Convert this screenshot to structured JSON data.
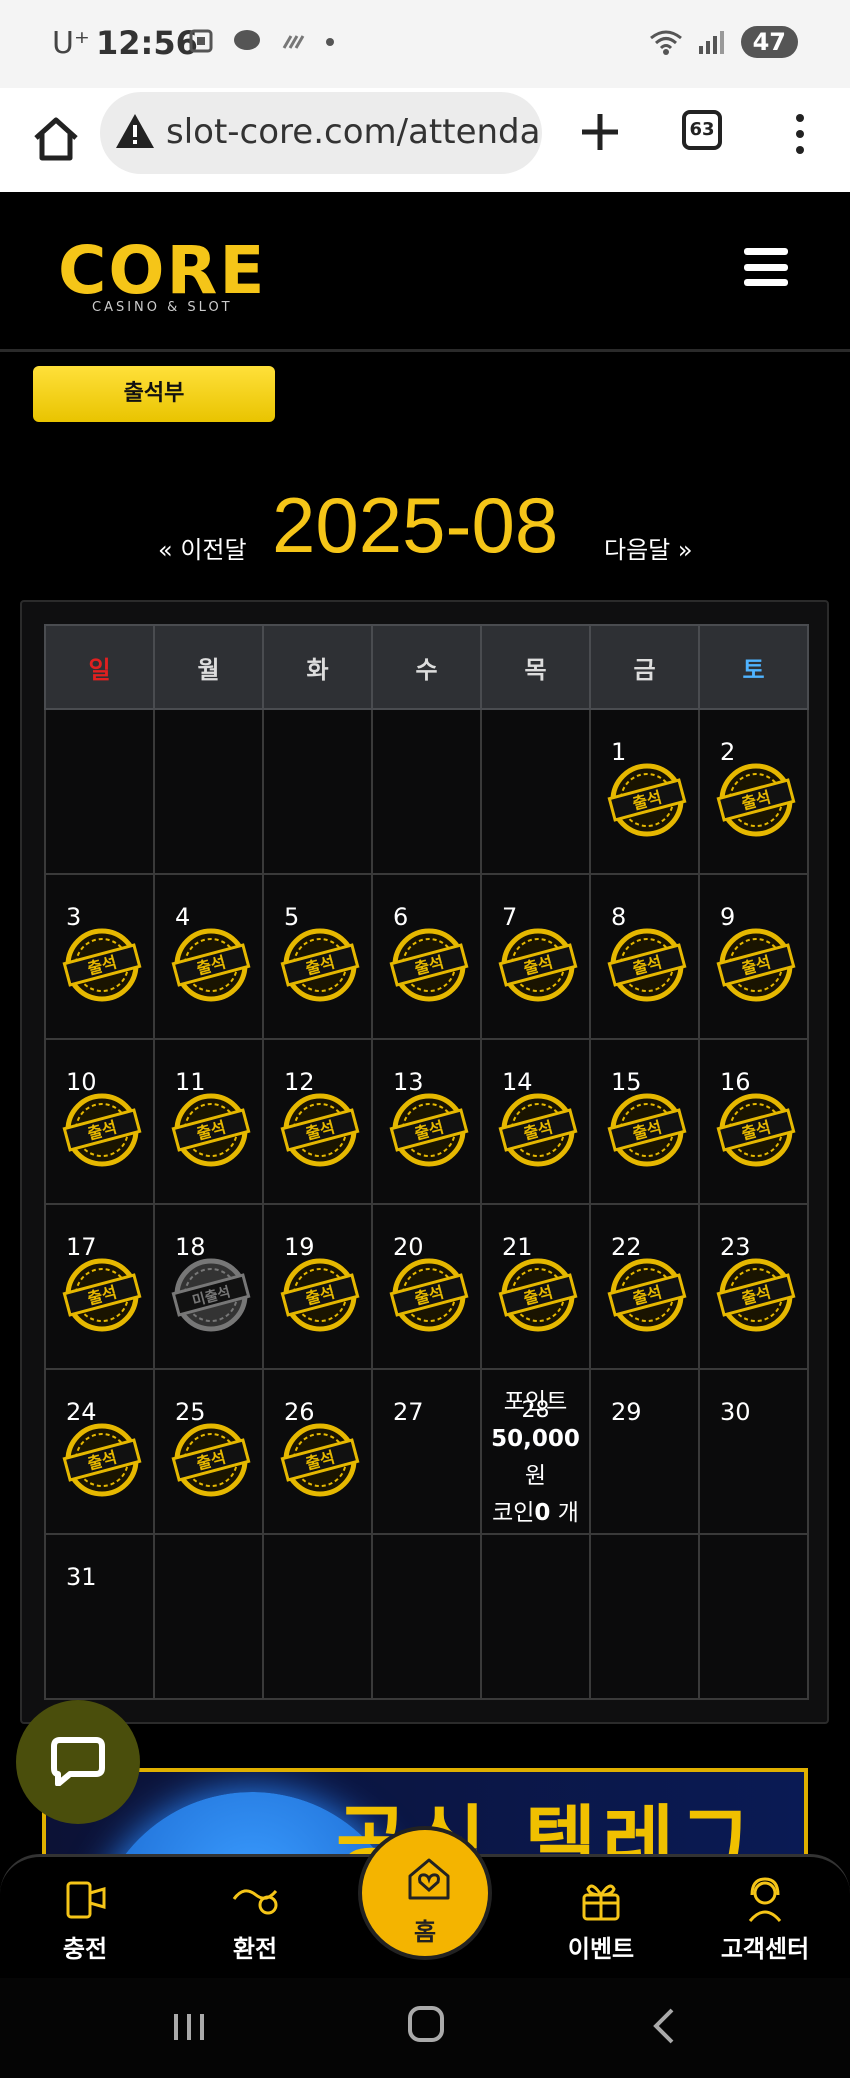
{
  "status_bar": {
    "carrier": "U⁺",
    "time": "12:56",
    "battery": "47"
  },
  "browser": {
    "url": "slot-core.com/attenda",
    "tab_count": "63"
  },
  "site": {
    "logo_text": "CORE",
    "logo_subtitle": "CASINO & SLOT"
  },
  "page": {
    "title_button": "출석부",
    "prev_month": "« 이전달",
    "current_month": "2025-08",
    "next_month": "다음달 »"
  },
  "calendar": {
    "weekdays": [
      "일",
      "월",
      "화",
      "수",
      "목",
      "금",
      "토"
    ],
    "weeks": [
      [
        {
          "day": ""
        },
        {
          "day": ""
        },
        {
          "day": ""
        },
        {
          "day": ""
        },
        {
          "day": ""
        },
        {
          "day": "1",
          "status": "출석"
        },
        {
          "day": "2",
          "status": "출석"
        }
      ],
      [
        {
          "day": "3",
          "status": "출석"
        },
        {
          "day": "4",
          "status": "출석"
        },
        {
          "day": "5",
          "status": "출석"
        },
        {
          "day": "6",
          "status": "출석"
        },
        {
          "day": "7",
          "status": "출석"
        },
        {
          "day": "8",
          "status": "출석"
        },
        {
          "day": "9",
          "status": "출석"
        }
      ],
      [
        {
          "day": "10",
          "status": "출석"
        },
        {
          "day": "11",
          "status": "출석"
        },
        {
          "day": "12",
          "status": "출석"
        },
        {
          "day": "13",
          "status": "출석"
        },
        {
          "day": "14",
          "status": "출석"
        },
        {
          "day": "15",
          "status": "출석"
        },
        {
          "day": "16",
          "status": "출석"
        }
      ],
      [
        {
          "day": "17",
          "status": "출석"
        },
        {
          "day": "18",
          "status": "미출석"
        },
        {
          "day": "19",
          "status": "출석"
        },
        {
          "day": "20",
          "status": "출석"
        },
        {
          "day": "21",
          "status": "출석"
        },
        {
          "day": "22",
          "status": "출석"
        },
        {
          "day": "23",
          "status": "출석"
        }
      ],
      [
        {
          "day": "24",
          "status": "출석"
        },
        {
          "day": "25",
          "status": "출석"
        },
        {
          "day": "26",
          "status": "출석"
        },
        {
          "day": "27"
        },
        {
          "day": "28",
          "today": true
        },
        {
          "day": "29"
        },
        {
          "day": "30"
        }
      ],
      [
        {
          "day": "31"
        },
        {
          "day": ""
        },
        {
          "day": ""
        },
        {
          "day": ""
        },
        {
          "day": ""
        },
        {
          "day": ""
        },
        {
          "day": ""
        }
      ]
    ],
    "today_info": {
      "point_label": "포인트",
      "point_amount": "50,000",
      "point_unit": "원",
      "coin_label": "코인",
      "coin_amount": "0",
      "coin_unit": "개"
    }
  },
  "banner": {
    "text": "공식 텔레그램"
  },
  "bottom_nav": {
    "charge": "충전",
    "exchange": "환전",
    "home": "홈",
    "event": "이벤트",
    "support": "고객센터"
  },
  "colors": {
    "accent": "#f5c518",
    "sunday": "#e02020",
    "saturday": "#4fb3ff"
  }
}
